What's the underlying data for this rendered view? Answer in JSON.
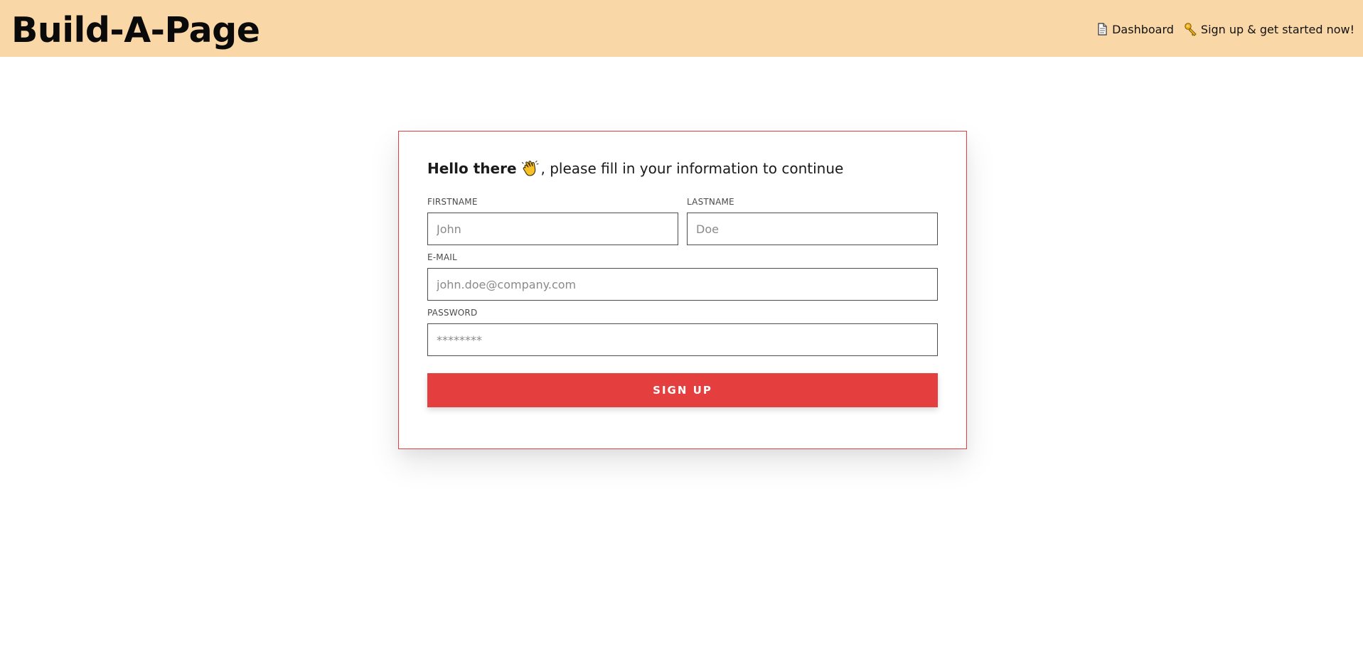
{
  "app": {
    "brand": "Build-A-Page"
  },
  "nav": {
    "dashboard": {
      "icon": "document-icon",
      "label": "Dashboard"
    },
    "signup": {
      "icon": "key-icon",
      "label": "Sign up & get started now!"
    }
  },
  "form": {
    "greeting_strong": "Hello there",
    "greeting_rest": ", please fill in your information to continue",
    "greeting_icon": "waving-hand-icon",
    "firstname": {
      "label": "FIRSTNAME",
      "placeholder": "John",
      "value": ""
    },
    "lastname": {
      "label": "LASTNAME",
      "placeholder": "Doe",
      "value": ""
    },
    "email": {
      "label": "E-MAIL",
      "placeholder": "john.doe@company.com",
      "value": ""
    },
    "password": {
      "label": "PASSWORD",
      "placeholder": "********",
      "value": ""
    },
    "submit_label": "SIGN UP"
  },
  "colors": {
    "topbar": "#fad7a6",
    "accent": "#e53e3e"
  }
}
